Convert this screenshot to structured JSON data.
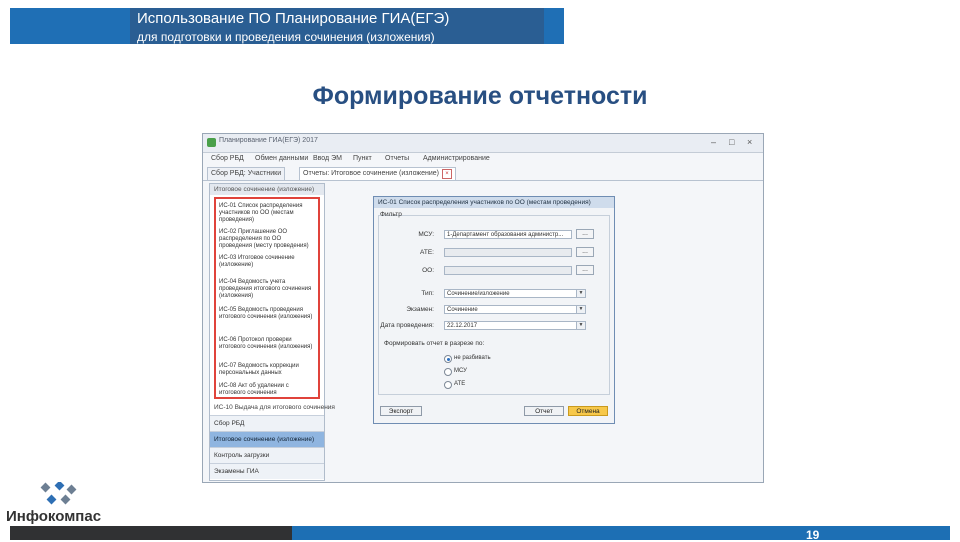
{
  "header": {
    "title": "Использование ПО Планирование ГИА(ЕГЭ)",
    "subtitle": "для подготовки и проведения сочинения (изложения)"
  },
  "slide_title": "Формирование отчетности",
  "app": {
    "window_title": "Планирование ГИА(ЕГЭ) 2017",
    "window_buttons": [
      "–",
      "□",
      "×"
    ],
    "menu": [
      "Сбор РБД",
      "Обмен данными",
      "Ввод ЭМ",
      "Пункт",
      "Отчеты",
      "Администрирование"
    ],
    "tabs": [
      {
        "label": "Сбор РБД: Участники"
      },
      {
        "label": "Отчеты: Итоговое сочинение (изложение)"
      }
    ],
    "left_panel": {
      "header": "Итоговое сочинение (изложение)",
      "reports": [
        "ИС-01 Список распределения участников по ОО (местам проведения)",
        "ИС-02 Приглашение ОО распределения по ОО проведения (месту проведения)",
        "ИС-03 Итоговое сочинение (изложение)",
        "ИС-04 Ведомость учета проведения итогового сочинения (изложения)",
        "ИС-05 Ведомость проведения итогового сочинения (изложения)",
        "ИС-06 Протокол проверки итогового сочинения (изложения)",
        "ИС-07 Ведомость коррекции персональных данных",
        "ИС-08 Акт об удалении с итогового сочинения"
      ],
      "bottom_item": "ИС-10 Выдача для итогового сочинения",
      "groups": [
        "Сбор РБД",
        "Итоговое сочинение (изложение)",
        "Контроль загрузки",
        "Экзамены ГИА"
      ],
      "active_group_index": 1
    },
    "dialog": {
      "title": "ИС-01 Список распределения участников по ОО (местам проведения)",
      "filter_label": "Фильтр",
      "fields": [
        {
          "label": "МСУ:",
          "value": "1-Департамент образования администр...",
          "type": "text",
          "has_button": true
        },
        {
          "label": "АТЕ:",
          "value": "",
          "type": "text-disabled",
          "has_button": true
        },
        {
          "label": "ОО:",
          "value": "",
          "type": "text-disabled",
          "has_button": true
        },
        {
          "label": "Тип:",
          "value": "Сочинение/изложение",
          "type": "select"
        },
        {
          "label": "Экзамен:",
          "value": "Сочинение",
          "type": "select"
        },
        {
          "label": "Дата проведения:",
          "value": "22.12.2017",
          "type": "select"
        }
      ],
      "group_label": "Формировать отчет в разрезе по:",
      "radios": [
        {
          "label": "не разбивать",
          "selected": true
        },
        {
          "label": "МСУ",
          "selected": false
        },
        {
          "label": "АТЕ",
          "selected": false
        }
      ],
      "buttons": {
        "export": "Экспорт",
        "report": "Отчет",
        "cancel": "Отмена"
      }
    }
  },
  "footer": {
    "logo_text": "Инфокомпас",
    "page_number": "19"
  },
  "colors": {
    "header_blue": "#1f6fb5",
    "title_blue": "#284f82",
    "highlight_red": "#e0433b",
    "footer_dark": "#303133"
  }
}
